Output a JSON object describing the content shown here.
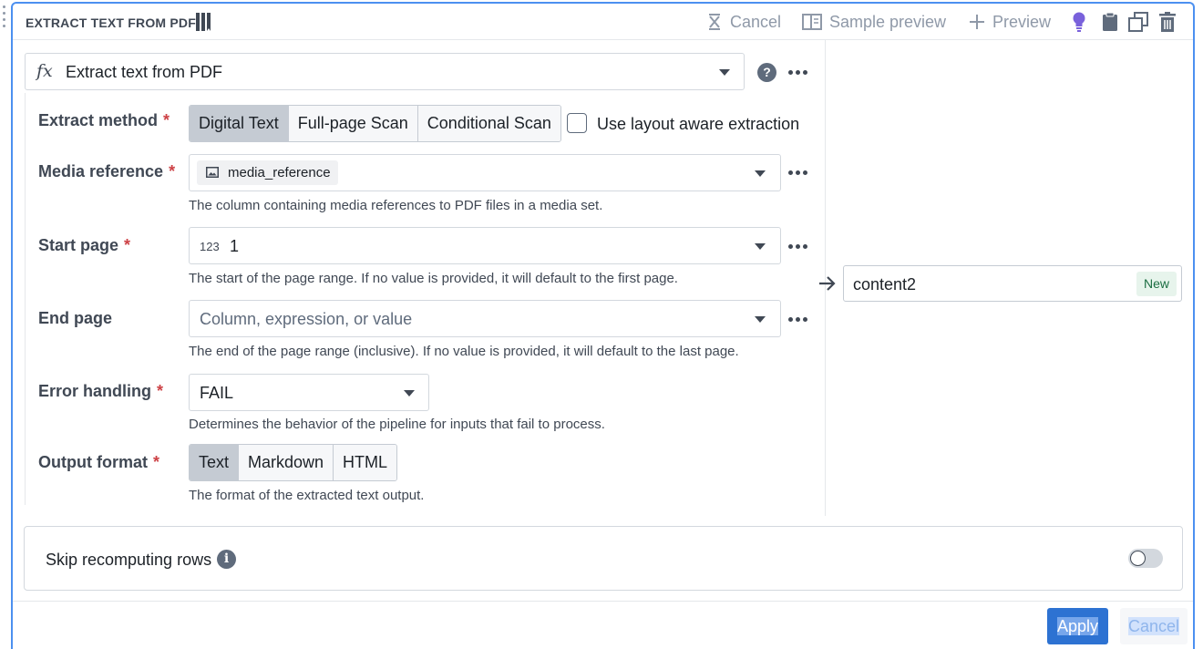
{
  "header": {
    "title": "EXTRACT TEXT FROM PDF",
    "cancel_label": "Cancel",
    "sample_preview_label": "Sample preview",
    "preview_label": "Preview"
  },
  "function": {
    "symbol": "fx",
    "label": "Extract text from PDF"
  },
  "fields": {
    "extract_method": {
      "label": "Extract method",
      "options": [
        "Digital Text",
        "Full-page Scan",
        "Conditional Scan"
      ],
      "selected": "Digital Text",
      "checkbox_label": "Use layout aware extraction"
    },
    "media_reference": {
      "label": "Media reference",
      "value": "media_reference",
      "help": "The column containing media references to PDF files in a media set."
    },
    "start_page": {
      "label": "Start page",
      "type_tag": "123",
      "value": "1",
      "help": "The start of the page range. If no value is provided, it will default to the first page."
    },
    "end_page": {
      "label": "End page",
      "placeholder": "Column, expression, or value",
      "help": "The end of the page range (inclusive). If no value is provided, it will default to the last page."
    },
    "error_handling": {
      "label": "Error handling",
      "value": "FAIL",
      "help": "Determines the behavior of the pipeline for inputs that fail to process."
    },
    "output_format": {
      "label": "Output format",
      "options": [
        "Text",
        "Markdown",
        "HTML"
      ],
      "selected": "Text",
      "help": "The format of the extracted text output."
    }
  },
  "required_mark": "*",
  "output": {
    "column_name": "content2",
    "badge": "New"
  },
  "skip": {
    "label": "Skip recomputing rows",
    "info_glyph": "i",
    "enabled": false
  },
  "help_glyph": "?",
  "footer": {
    "apply_label": "Apply",
    "cancel_label": "Cancel"
  },
  "colors": {
    "accent": "#2d72d2",
    "frame": "#4c90f0",
    "required": "#cd4246",
    "badge_bg": "#e7f4ec",
    "badge_text": "#1c6e42",
    "lightbulb": "#7961db"
  }
}
